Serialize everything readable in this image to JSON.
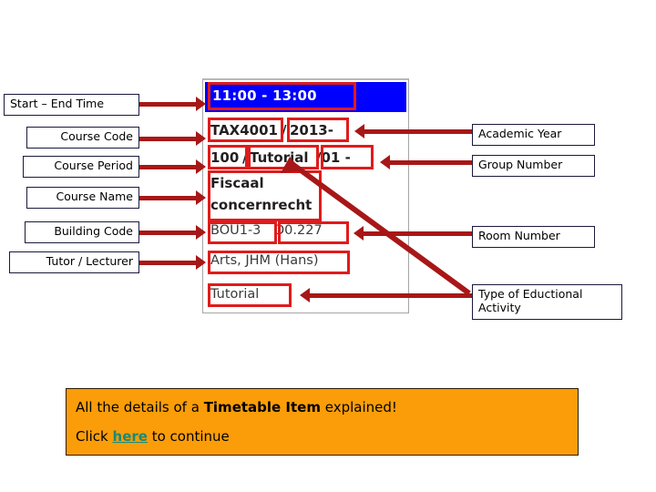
{
  "card": {
    "time": "11:00 - 13:00",
    "course_code": "TAX4001",
    "academic_year": "2013-",
    "course_period": "100",
    "activity_type_inline": "Tutorial",
    "group_number": "/01 -",
    "course_name_line1": "Fiscaal",
    "course_name_line2": "concernrecht",
    "building_code": "BOU1-3",
    "room_number": "D0.227",
    "tutor": "Arts, JHM (Hans)",
    "activity_type": "Tutorial",
    "time_bar_color": "#0000ff",
    "highlight_color": "#e01b1b"
  },
  "labels_left": [
    {
      "text": "Start – End Time"
    },
    {
      "text": "Course Code"
    },
    {
      "text": "Course Period"
    },
    {
      "text": "Course Name"
    },
    {
      "text": "Building Code"
    },
    {
      "text": "Tutor / Lecturer"
    }
  ],
  "labels_right": [
    {
      "text": "Academic Year"
    },
    {
      "text": "Group Number"
    },
    {
      "text": "Room Number"
    },
    {
      "text_line1": "Type of Eductional",
      "text_line2": "Activity"
    }
  ],
  "footer": {
    "line1_prefix": "All the details of a ",
    "line1_bold": "Timetable Item",
    "line1_suffix": " explained!",
    "line2_prefix": "Click ",
    "line2_link": "here",
    "line2_suffix": " to continue",
    "background": "#FB9D09",
    "link_color": "#1a8a72"
  }
}
